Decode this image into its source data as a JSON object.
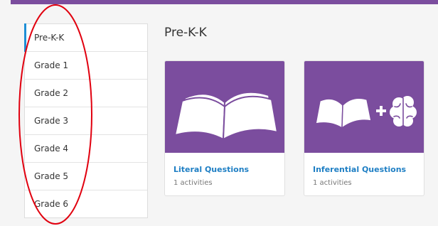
{
  "colors": {
    "brand": "#7b4d9e",
    "active_indicator": "#1f8fd6",
    "link": "#1f7fc4",
    "annotation": "#e1000f"
  },
  "sidebar": {
    "items": [
      {
        "label": "Pre-K-K",
        "active": true
      },
      {
        "label": "Grade 1"
      },
      {
        "label": "Grade 2"
      },
      {
        "label": "Grade 3"
      },
      {
        "label": "Grade 4"
      },
      {
        "label": "Grade 5"
      },
      {
        "label": "Grade 6"
      }
    ]
  },
  "main": {
    "title": "Pre-K-K",
    "cards": [
      {
        "title": "Literal Questions",
        "subtitle": "1 activities",
        "icon": "open-book-icon"
      },
      {
        "title": "Inferential Questions",
        "subtitle": "1 activities",
        "icon": "book-plus-brain-icon"
      }
    ]
  }
}
